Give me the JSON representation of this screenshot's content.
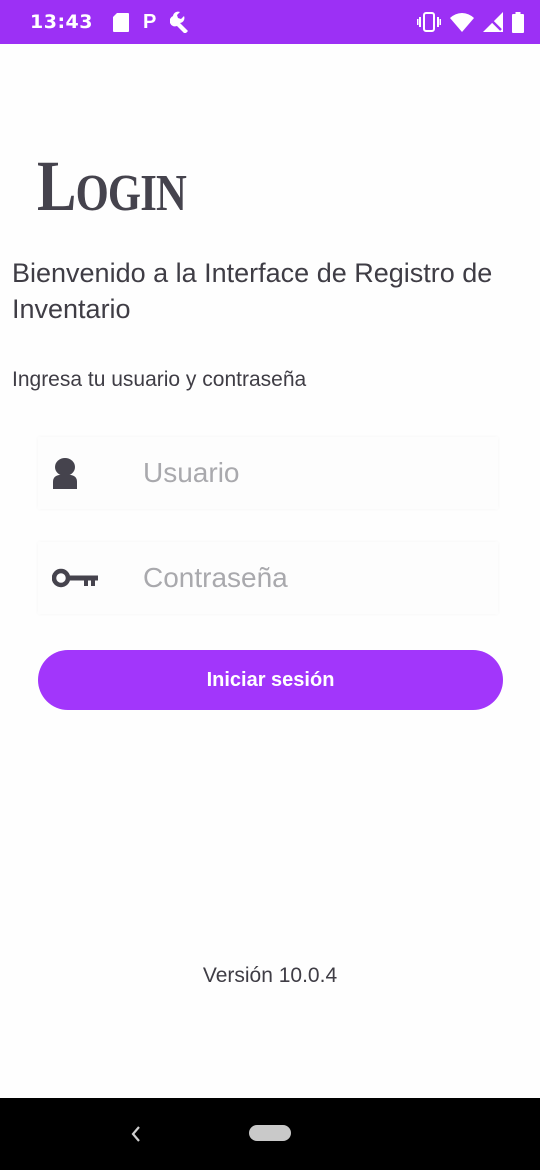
{
  "status_bar": {
    "time": "13:43",
    "left_icons": [
      "sd-card-icon",
      "p-icon",
      "wrench-icon"
    ],
    "p_glyph": "P",
    "right_icons": [
      "vibrate-icon",
      "wifi-icon",
      "no-signal-icon",
      "battery-icon"
    ],
    "background_color": "#9c30f5"
  },
  "header": {
    "title_first": "L",
    "title_rest": "OGIN"
  },
  "welcome_text": "Bienvenido a la Interface de Registro de Inventario",
  "instructions_text": "Ingresa tu usuario y contraseña",
  "form": {
    "username": {
      "placeholder": "Usuario",
      "value": "",
      "icon": "user-icon"
    },
    "password": {
      "placeholder": "Contraseña",
      "value": "",
      "icon": "key-icon"
    },
    "submit_label": "Iniciar sesión",
    "accent_color": "#a236fb"
  },
  "version_text": "Versión 10.0.4",
  "nav_bar": {
    "back_icon": "back-chevron-icon",
    "home_icon": "home-pill-icon"
  }
}
